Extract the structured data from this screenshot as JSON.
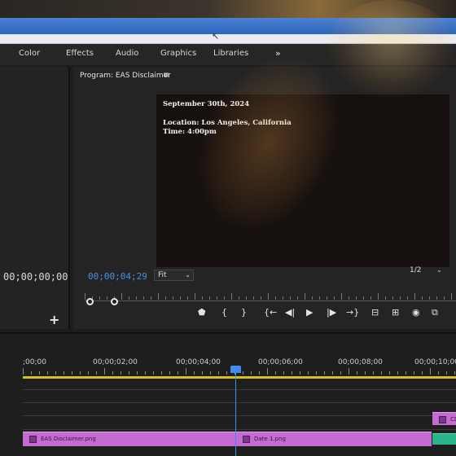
{
  "workspaces": {
    "tabs": [
      "Color",
      "Effects",
      "Audio",
      "Graphics",
      "Libraries"
    ],
    "more": "»"
  },
  "source_panel": {
    "timecode": "00;00;00;00",
    "add": "+"
  },
  "program_monitor": {
    "title": "Program: EAS Disclaimer",
    "menu_icon": "≡",
    "overlay": {
      "line1": "September 30th, 2024",
      "line2": "Location: Los Angeles, California",
      "line3": "Time: 4:00pm"
    },
    "timecode": "00;00;04;29",
    "zoom": "Fit",
    "resolution": "1/2",
    "transport": {
      "icons": [
        "marker-icon",
        "mark-in-icon",
        "mark-out-icon",
        "go-to-in-icon",
        "step-back-icon",
        "play-icon",
        "step-forward-icon",
        "go-to-out-icon",
        "lift-icon",
        "extract-icon",
        "export-frame-icon",
        "comparison-view-icon"
      ],
      "glyphs": [
        "⬟",
        "{",
        "}",
        "{←",
        "◀|",
        "▶",
        "|▶",
        "→}",
        "⊟",
        "⊞",
        "◉",
        "⧉"
      ]
    }
  },
  "timeline": {
    "ruler": [
      ";00;00",
      "00;00;02;00",
      "00;00;04;00",
      "00;00;06;00",
      "00;00;08;00",
      "00;00;10;00"
    ],
    "clips": [
      {
        "name": "EAS Disclaimer.png"
      },
      {
        "name": "Date 1.png"
      },
      {
        "name": "CD"
      }
    ],
    "colors": {
      "clip": "#c46bd1",
      "playhead": "#3d8ef0",
      "work_area": "#d6c21c",
      "timecode": "#4a90e8"
    }
  }
}
